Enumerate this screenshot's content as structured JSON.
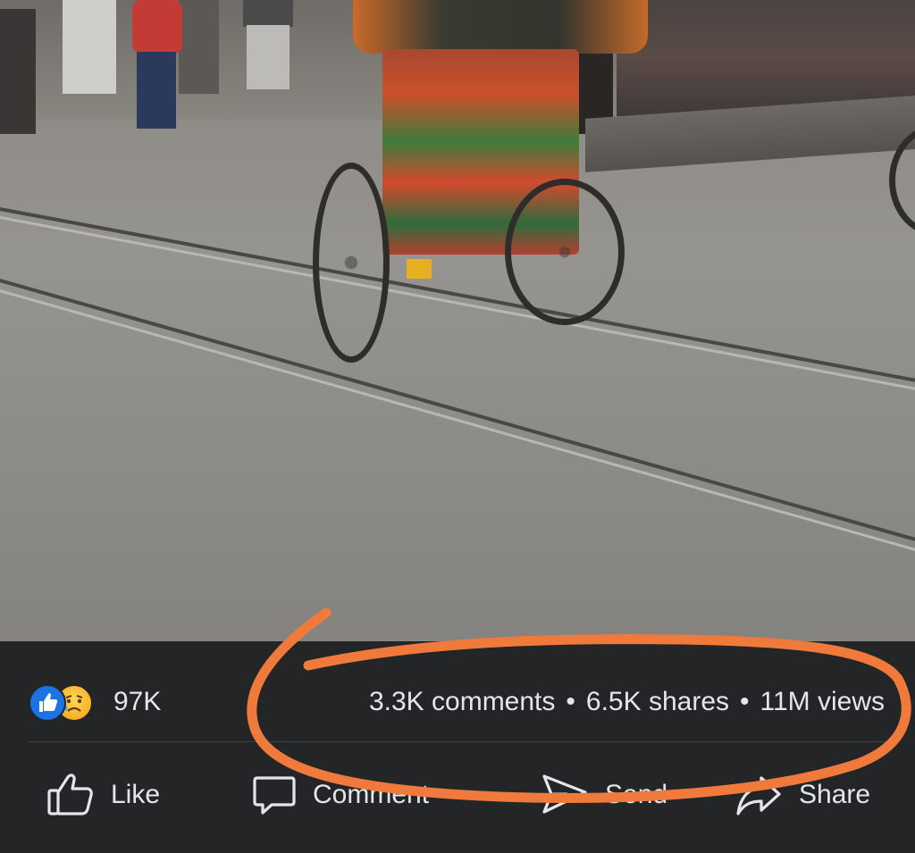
{
  "post": {
    "reactions": {
      "icons": [
        "like-reaction-icon",
        "sad-reaction-icon"
      ],
      "count": "97K"
    },
    "stats": {
      "comments": "3.3K comments",
      "shares": "6.5K shares",
      "views": "11M views",
      "separator": "•"
    },
    "actions": {
      "like": "Like",
      "comment": "Comment",
      "send": "Send",
      "share": "Share"
    }
  },
  "colors": {
    "background": "#242526",
    "text": "#e4e6eb",
    "like_blue": "#1b74e4",
    "annotation_orange": "#f07a3c"
  }
}
